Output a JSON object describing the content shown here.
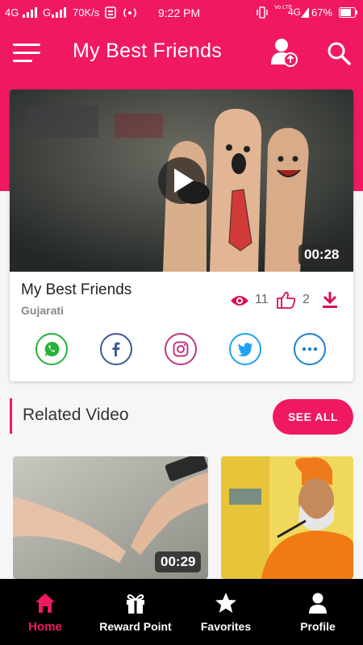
{
  "status_bar": {
    "network1": "4G",
    "network2": "G",
    "speed": "70K/s",
    "time": "9:22 PM",
    "battery": "67%",
    "volte": "Vo LTE",
    "network3": "4G"
  },
  "app_bar": {
    "title": "My Best Friends",
    "icons": [
      "menu-icon",
      "user-upload-icon",
      "search-icon"
    ]
  },
  "featured_video": {
    "duration": "00:28",
    "title": "My Best Friends",
    "language": "Gujarati",
    "views": "11",
    "likes": "2",
    "share_targets": [
      "whatsapp",
      "facebook",
      "instagram",
      "twitter",
      "more"
    ]
  },
  "related": {
    "section_title": "Related Video",
    "see_all_label": "SEE ALL",
    "items": [
      {
        "duration": "00:29"
      },
      {
        "duration": ""
      }
    ]
  },
  "bottom_nav": {
    "items": [
      {
        "label": "Home",
        "icon": "home-icon",
        "active": true
      },
      {
        "label": "Reward Point",
        "icon": "gift-icon",
        "active": false
      },
      {
        "label": "Favorites",
        "icon": "star-icon",
        "active": false
      },
      {
        "label": "Profile",
        "icon": "person-icon",
        "active": false
      }
    ]
  },
  "colors": {
    "accent": "#f0195f",
    "whatsapp": "#25b23b",
    "facebook": "#3b5998",
    "instagram": "#c13584",
    "twitter": "#1da1f2",
    "more": "#1e7fd0",
    "nav_background": "#000000"
  }
}
